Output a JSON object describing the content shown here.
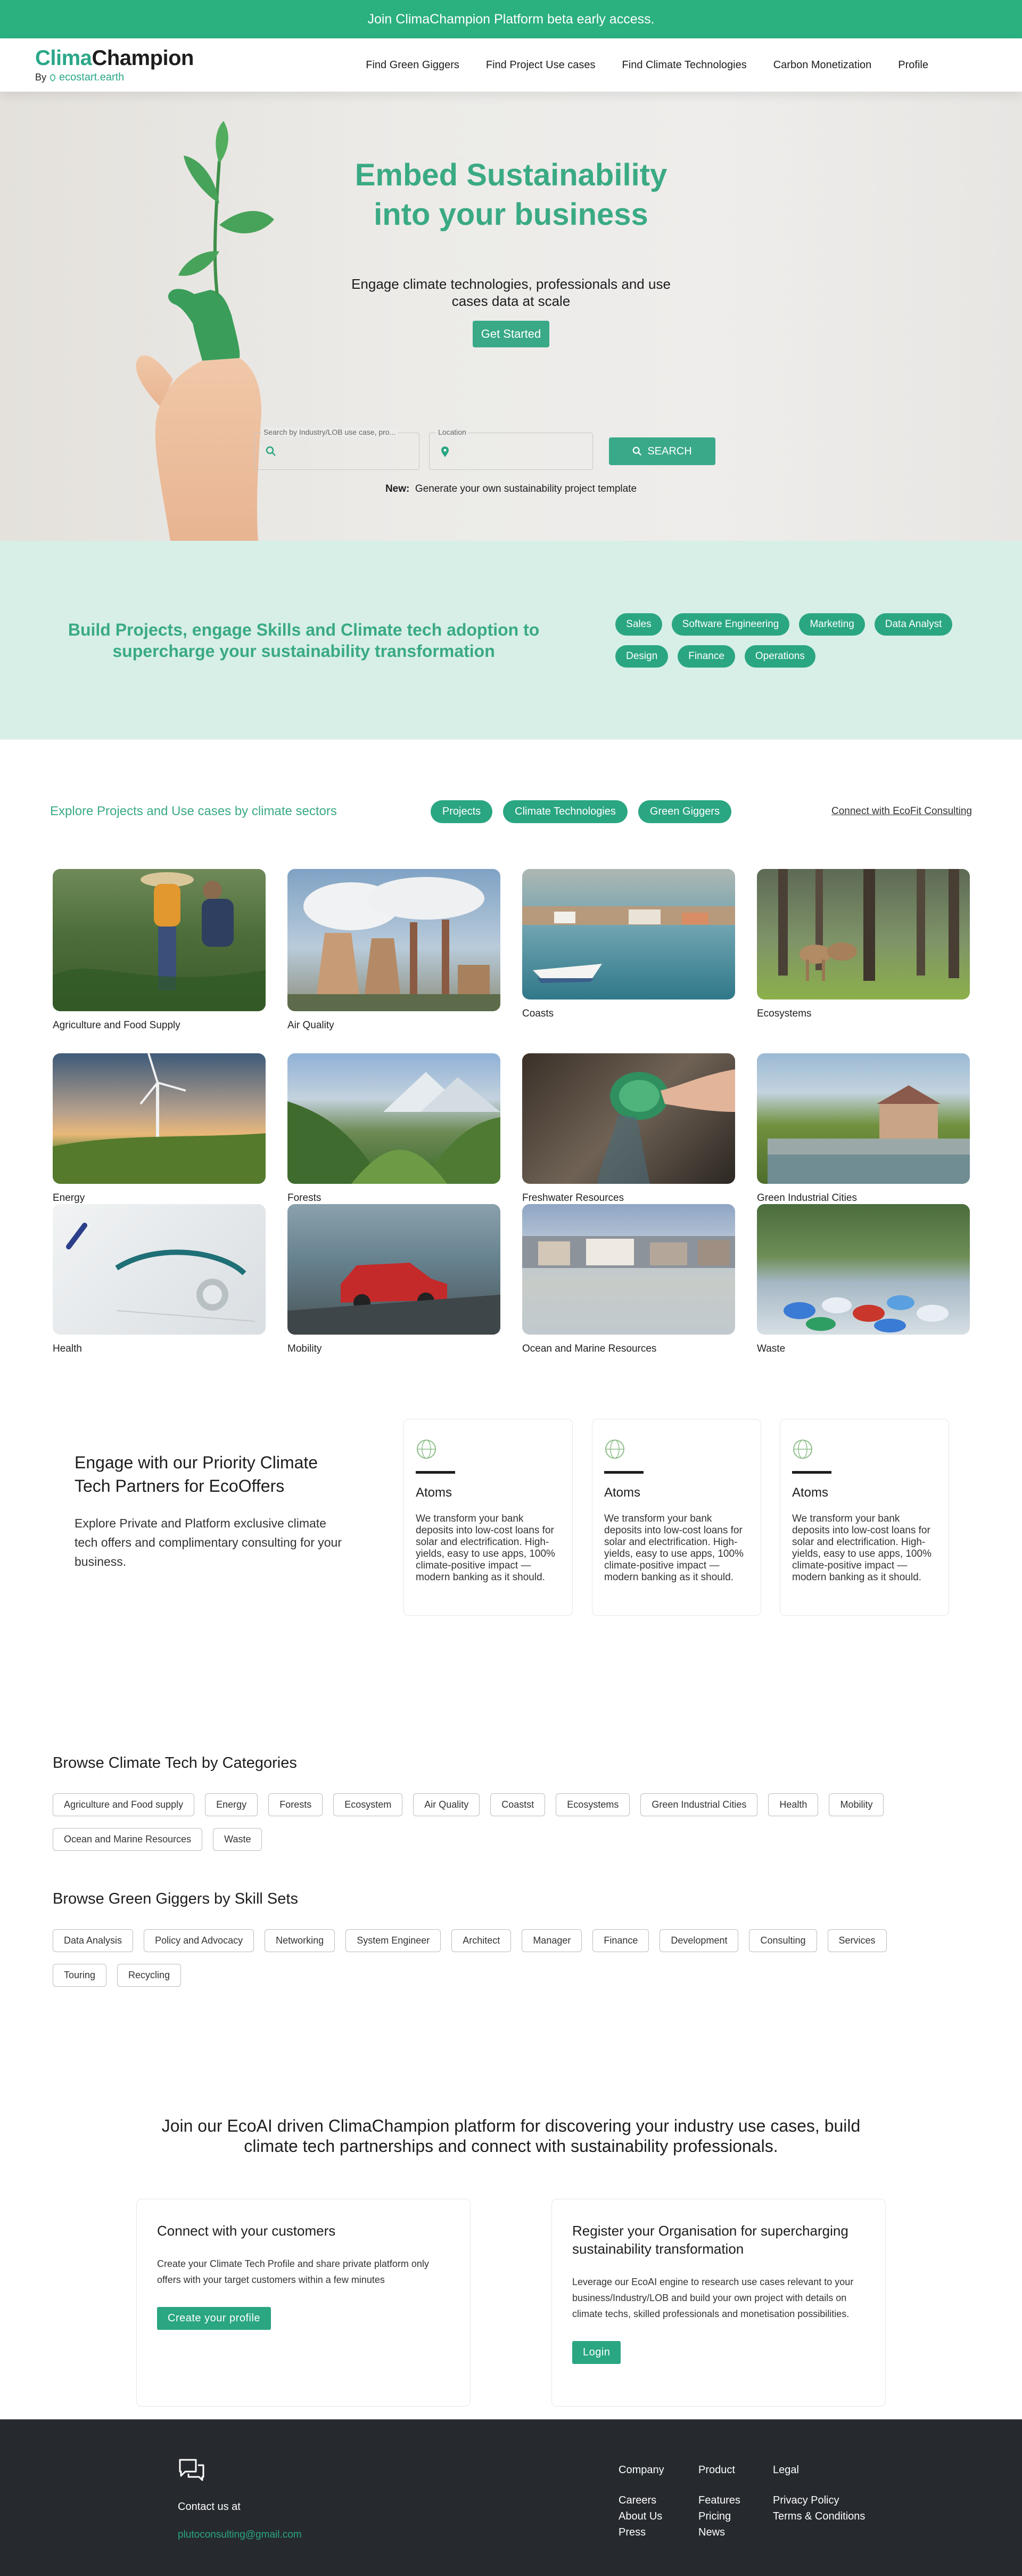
{
  "announcement": "Join ClimaChampion Platform beta early access.",
  "header": {
    "logo_clima": "Clima",
    "logo_champion": "Champion",
    "logo_by": "By",
    "logo_eco": "ecostart.earth",
    "nav": [
      "Find Green Giggers",
      "Find Project Use cases",
      "Find Climate Technologies",
      "Carbon Monetization",
      "Profile"
    ]
  },
  "hero": {
    "title_line1": "Embed Sustainability",
    "title_line2": "into your business",
    "subtitle_line1": "Engage climate technologies, professionals and use",
    "subtitle_line2": "cases data at scale",
    "cta": "Get Started",
    "search_label": "Search by Industry/LOB use case, pro...",
    "location_label": "Location",
    "search_button": "SEARCH",
    "new_label": "New:",
    "new_text": "Generate your own sustainability project template"
  },
  "band": {
    "text": "Build Projects, engage Skills and Climate tech adoption to supercharge your sustainability transformation",
    "tags": [
      "Sales",
      "Software Engineering",
      "Marketing",
      "Data Analyst",
      "Design",
      "Finance",
      "Operations"
    ]
  },
  "explore": {
    "title": "Explore Projects and Use cases by climate sectors",
    "pills": [
      "Projects",
      "Climate Technologies",
      "Green Giggers"
    ],
    "link": "Connect with EcoFit Consulting",
    "sectors": [
      "Agriculture and Food Supply",
      "Air Quality",
      "Coasts",
      "Ecosystems",
      "Energy",
      "Forests",
      "Freshwater Resources",
      "Green Industrial Cities",
      "Health",
      "Mobility",
      "Ocean and Marine Resources",
      "Waste"
    ]
  },
  "partners": {
    "title": "Engage with our Priority Climate Tech Partners for EcoOffers",
    "desc": "Explore Private and Platform exclusive climate tech offers and complimentary consulting for your business.",
    "cards": [
      {
        "title": "Atoms",
        "desc": "We transform your bank deposits into low-cost loans for solar and electrification. High-yields, easy to use apps, 100% climate-positive impact — modern banking as it should."
      },
      {
        "title": "Atoms",
        "desc": "We transform your bank deposits into low-cost loans for solar and electrification. High-yields, easy to use apps, 100% climate-positive impact — modern banking as it should."
      },
      {
        "title": "Atoms",
        "desc": "We transform your bank deposits into low-cost loans for solar and electrification. High-yields, easy to use apps, 100% climate-positive impact — modern banking as it should."
      }
    ]
  },
  "browse_categories": {
    "title": "Browse Climate Tech by Categories",
    "chips": [
      "Agriculture and Food supply",
      "Energy",
      "Forests",
      "Ecosystem",
      "Air Quality",
      "Coastst",
      "Ecosystems",
      "Green Industrial Cities",
      "Health",
      "Mobility",
      "Ocean and Marine Resources",
      "Waste"
    ]
  },
  "browse_skills": {
    "title": "Browse Green Giggers by Skill Sets",
    "chips": [
      "Data Analysis",
      "Policy and Advocacy",
      "Networking",
      "System Engineer",
      "Architect",
      "Manager",
      "Finance",
      "Development",
      "Consulting",
      "Services",
      "Touring",
      "Recycling"
    ]
  },
  "join": {
    "headline": "Join our EcoAI driven ClimaChampion platform for discovering your industry use cases, build climate tech partnerships and connect with sustainability professionals.",
    "card1": {
      "title": "Connect with your customers",
      "desc": "Create your Climate Tech Profile and share private platform only offers with your target customers within a few minutes",
      "button": "Create your profile"
    },
    "card2": {
      "title": "Register your Organisation for supercharging sustainability transformation",
      "desc": "Leverage our EcoAI engine to research use cases relevant to your business/Industry/LOB and build your own project with details on climate techs, skilled professionals and monetisation possibilities.",
      "button": "Login"
    }
  },
  "footer": {
    "contact_label": "Contact us at",
    "email": "plutoconsulting@gmail.com",
    "columns": [
      {
        "head": "Company",
        "items": [
          "Careers",
          "About Us",
          "Press"
        ]
      },
      {
        "head": "Product",
        "items": [
          "Features",
          "Pricing",
          "News"
        ]
      },
      {
        "head": "Legal",
        "items": [
          "Privacy Policy",
          "Terms & Conditions"
        ]
      }
    ]
  },
  "colors": {
    "brand_green": "#2aa682",
    "title_green": "#3aaa84",
    "band_bg": "#d7efe7",
    "footer_bg": "#262a2e"
  }
}
